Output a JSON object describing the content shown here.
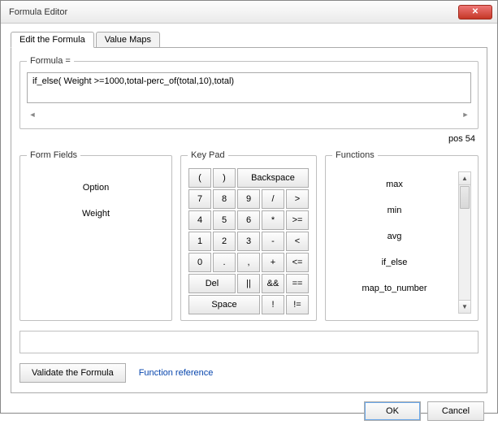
{
  "window": {
    "title": "Formula Editor",
    "close_glyph": "✕"
  },
  "tabs": {
    "edit": "Edit the Formula",
    "maps": "Value Maps"
  },
  "formula": {
    "legend": "Formula =",
    "value": "if_else( Weight >=1000,total-perc_of(total,10),total)",
    "scroll_left": "◄",
    "scroll_right": "►",
    "pos_label": "pos 54"
  },
  "formfields": {
    "legend": "Form Fields",
    "items": [
      "Option",
      "Weight"
    ]
  },
  "keypad": {
    "legend": "Key Pad",
    "rows": [
      [
        "(",
        ")",
        "Backspace"
      ],
      [
        "7",
        "8",
        "9",
        "/",
        ">"
      ],
      [
        "4",
        "5",
        "6",
        "*",
        ">="
      ],
      [
        "1",
        "2",
        "3",
        "-",
        "<"
      ],
      [
        "0",
        ".",
        ",",
        "+",
        "<="
      ],
      [
        "Del",
        "||",
        "&&",
        "=="
      ],
      [
        "Space",
        "!",
        "!="
      ]
    ]
  },
  "functions": {
    "legend": "Functions",
    "items": [
      "max",
      "min",
      "avg",
      "if_else",
      "map_to_number"
    ],
    "up": "▲",
    "down": "▼"
  },
  "actions": {
    "validate": "Validate the Formula",
    "reference": "Function reference",
    "ok": "OK",
    "cancel": "Cancel"
  }
}
